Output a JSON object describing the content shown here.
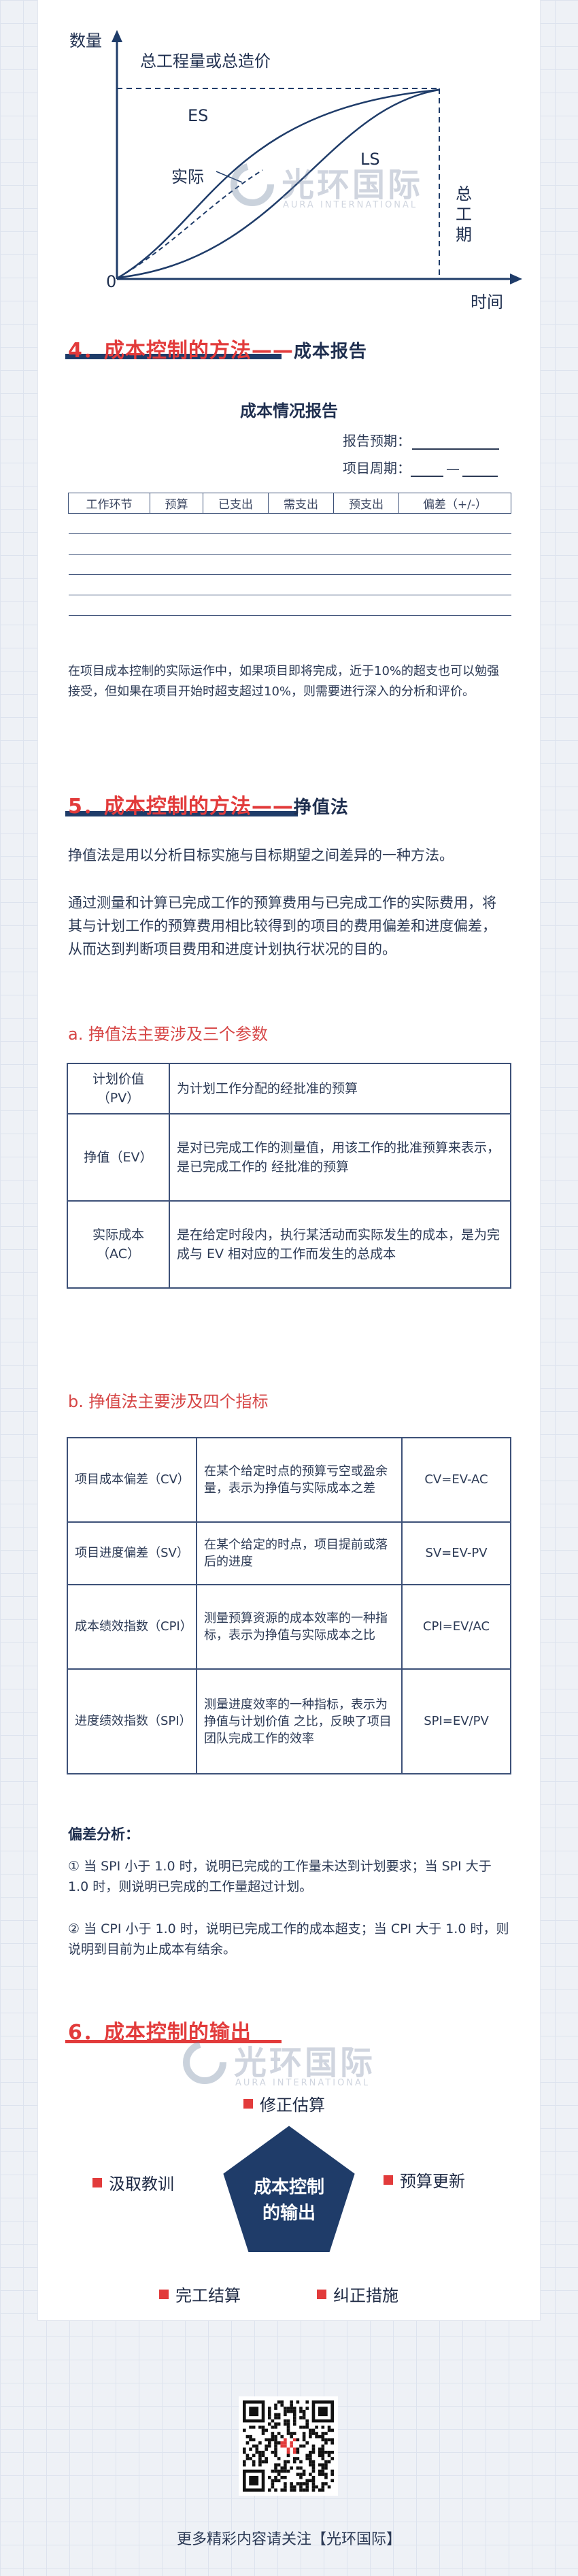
{
  "diagram": {
    "y_label": "数量",
    "total_label": "总工程量或总造价",
    "es_label": "ES",
    "ls_label": "LS",
    "actual_label": "实际",
    "origin_label": "0",
    "x_label": "时间",
    "duration_label": [
      "总",
      "工",
      "期"
    ]
  },
  "watermark": {
    "name": "光环国际",
    "sub": "AURA INTERNATIONAL"
  },
  "section4": {
    "title_prefix": "4．成本控制的方法——",
    "title_suffix": "成本报告",
    "report_title": "成本情况报告",
    "report_period_label": "报告预期：",
    "project_period_label": "项目周期：",
    "project_period_sep": "—",
    "columns": [
      "工作环节",
      "预算",
      "已支出",
      "需支出",
      "预支出",
      "偏差（+/-）"
    ],
    "empty_rows": 5,
    "note": "在项目成本控制的实际运作中，如果项目即将完成，近于10%的超支也可以勉强接受，但如果在项目开始时超支超过10%，则需要进行深入的分析和评价。"
  },
  "section5": {
    "title_prefix": "5．成本控制的方法——",
    "title_suffix": "挣值法",
    "intro1": "挣值法是用以分析目标实施与目标期望之间差异的一种方法。",
    "intro2": "通过测量和计算已完成工作的预算费用与已完成工作的实际费用，将其与计划工作的预算费用相比较得到的项目的费用偏差和进度偏差，从而达到判断项目费用和进度计划执行状况的目的。",
    "params_head": "a. 挣值法主要涉及三个参数",
    "params": [
      {
        "name": "计划价值（PV）",
        "desc": "为计划工作分配的经批准的预算"
      },
      {
        "name": "挣值（EV）",
        "desc": "是对已完成工作的测量值，用该工作的批准预算来表示，是已完成工作的 经批准的预算"
      },
      {
        "name": "实际成本（AC）",
        "desc": "是在给定时段内，执行某活动而实际发生的成本，是为完成与 EV 相对应的工作而发生的总成本"
      }
    ],
    "indicators_head": "b. 挣值法主要涉及四个指标",
    "indicators": [
      {
        "name": "项目成本偏差（CV）",
        "desc": "在某个给定时点的预算亏空或盈余量，表示为挣值与实际成本之差",
        "formula": "CV=EV-AC"
      },
      {
        "name": "项目进度偏差（SV）",
        "desc": "在某个给定的时点，项目提前或落后的进度",
        "formula": "SV=EV-PV"
      },
      {
        "name": "成本绩效指数（CPI）",
        "desc": "测量预算资源的成本效率的一种指标，表示为挣值与实际成本之比",
        "formula": "CPI=EV/AC"
      },
      {
        "name": "进度绩效指数（SPI）",
        "desc": "测量进度效率的一种指标，表示为挣值与计划价值 之比，反映了项目团队完成工作的效率",
        "formula": "SPI=EV/PV"
      }
    ],
    "deviation_head": "偏差分析：",
    "deviation1": "① 当 SPI 小于 1.0 时，说明已完成的工作量未达到计划要求；当 SPI 大于 1.0 时，则说明已完成的工作量超过计划。",
    "deviation2": "② 当 CPI 小于 1.0 时，说明已完成工作的成本超支；当 CPI 大于 1.0 时，则说明到目前为止成本有结余。"
  },
  "section6": {
    "title": "6．成本控制的输出",
    "center": [
      "成本控制",
      "的输出"
    ],
    "items": {
      "top": "修正估算",
      "left": "汲取教训",
      "right": "预算更新",
      "bottom_left": "完工结算",
      "bottom_right": "纠正措施"
    }
  },
  "footer": {
    "follow_text": "更多精彩内容请关注【光环国际】"
  },
  "colors": {
    "navy": "#1f3c69",
    "red": "#e23b3b",
    "text": "#2c3a55"
  }
}
